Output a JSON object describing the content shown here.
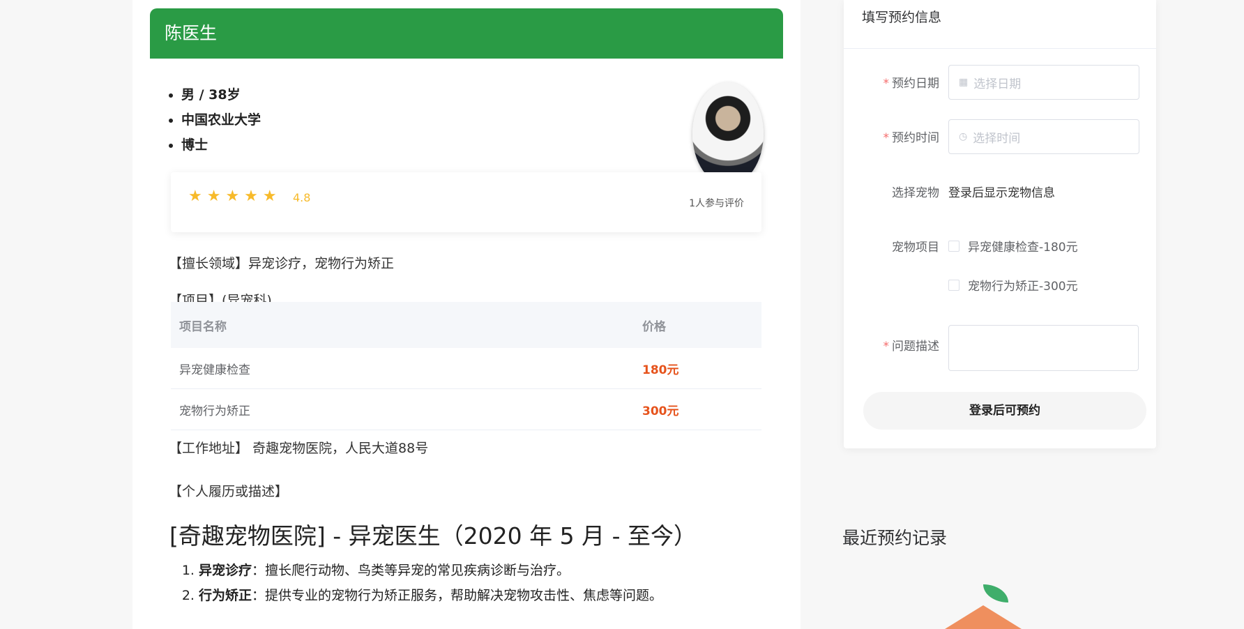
{
  "doctor": {
    "name": "陈医生",
    "attributes": [
      "男 / 38岁",
      "中国农业大学",
      "博士"
    ],
    "rating": {
      "stars": "★★★★★",
      "score": "4.8",
      "count_text": "1人参与评价"
    }
  },
  "specialty": "【擅长领域】异宠诊疗，宠物行为矫正",
  "projects": {
    "heading": "【项目】(异宠科)",
    "col_name": "项目名称",
    "col_price": "价格",
    "rows": [
      {
        "name": "异宠健康检查",
        "price": "180元"
      },
      {
        "name": "宠物行为矫正",
        "price": "300元"
      }
    ]
  },
  "address": "【工作地址】 奇趣宠物医院，人民大道88号",
  "resume": {
    "heading": "【个人履历或描述】",
    "title": "[奇趣宠物医院] - 异宠医生（2020 年 5 月 - 至今）",
    "items": [
      {
        "label": "异宠诊疗",
        "text": "：擅长爬行动物、鸟类等异宠的常见疾病诊断与治疗。"
      },
      {
        "label": "行为矫正",
        "text": "：提供专业的宠物行为矫正服务，帮助解决宠物攻击性、焦虑等问题。"
      }
    ]
  },
  "form": {
    "title": "填写预约信息",
    "date_label": "预约日期",
    "date_placeholder": "选择日期",
    "time_label": "预约时间",
    "time_placeholder": "选择时间",
    "pet_label": "选择宠物",
    "pet_value": "登录后显示宠物信息",
    "project_label": "宠物项目",
    "project_options": [
      "异宠健康检查-180元",
      "宠物行为矫正-300元"
    ],
    "desc_label": "问题描述",
    "submit_label": "登录后可预约"
  },
  "recent_title": "最近预约记录",
  "icons": {
    "date": "calendar-icon",
    "time": "clock-icon",
    "star": "star-icon"
  },
  "colors": {
    "header_green": "#2a9b45",
    "price_orange": "#e6531c",
    "star_yellow": "#f7ba2a",
    "required_red": "#f56c6c"
  }
}
